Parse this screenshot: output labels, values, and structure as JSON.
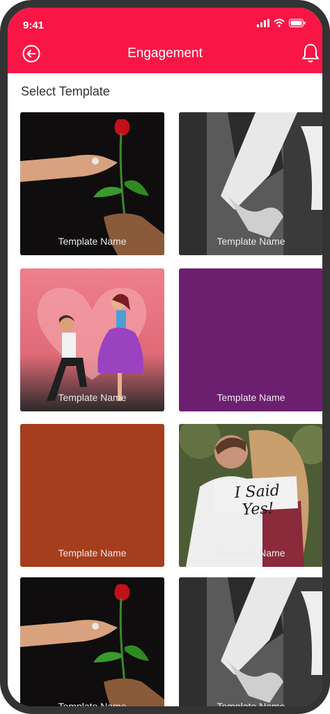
{
  "status": {
    "time": "9:41"
  },
  "header": {
    "title": "Engagement"
  },
  "section": {
    "title": "Select Template"
  },
  "colors": {
    "accent": "#f91646",
    "purple": "#6c1f6e",
    "rust": "#a63d1d"
  },
  "cards": [
    {
      "label": "Template Name",
      "image": "rose-ring-photo"
    },
    {
      "label": "Template Name",
      "image": "couple-heart-hands-photo"
    },
    {
      "label": "Template Name",
      "image": "proposal-cartoon"
    },
    {
      "label": "Template Name",
      "image": "purple-solid"
    },
    {
      "label": "Template Name",
      "image": "rust-solid"
    },
    {
      "label": "Template Name",
      "image": "i-said-yes-photo",
      "sign_text": "I Said Yes!"
    },
    {
      "label": "Template Name",
      "image": "rose-ring-photo"
    },
    {
      "label": "Template Name",
      "image": "couple-heart-hands-photo"
    }
  ]
}
